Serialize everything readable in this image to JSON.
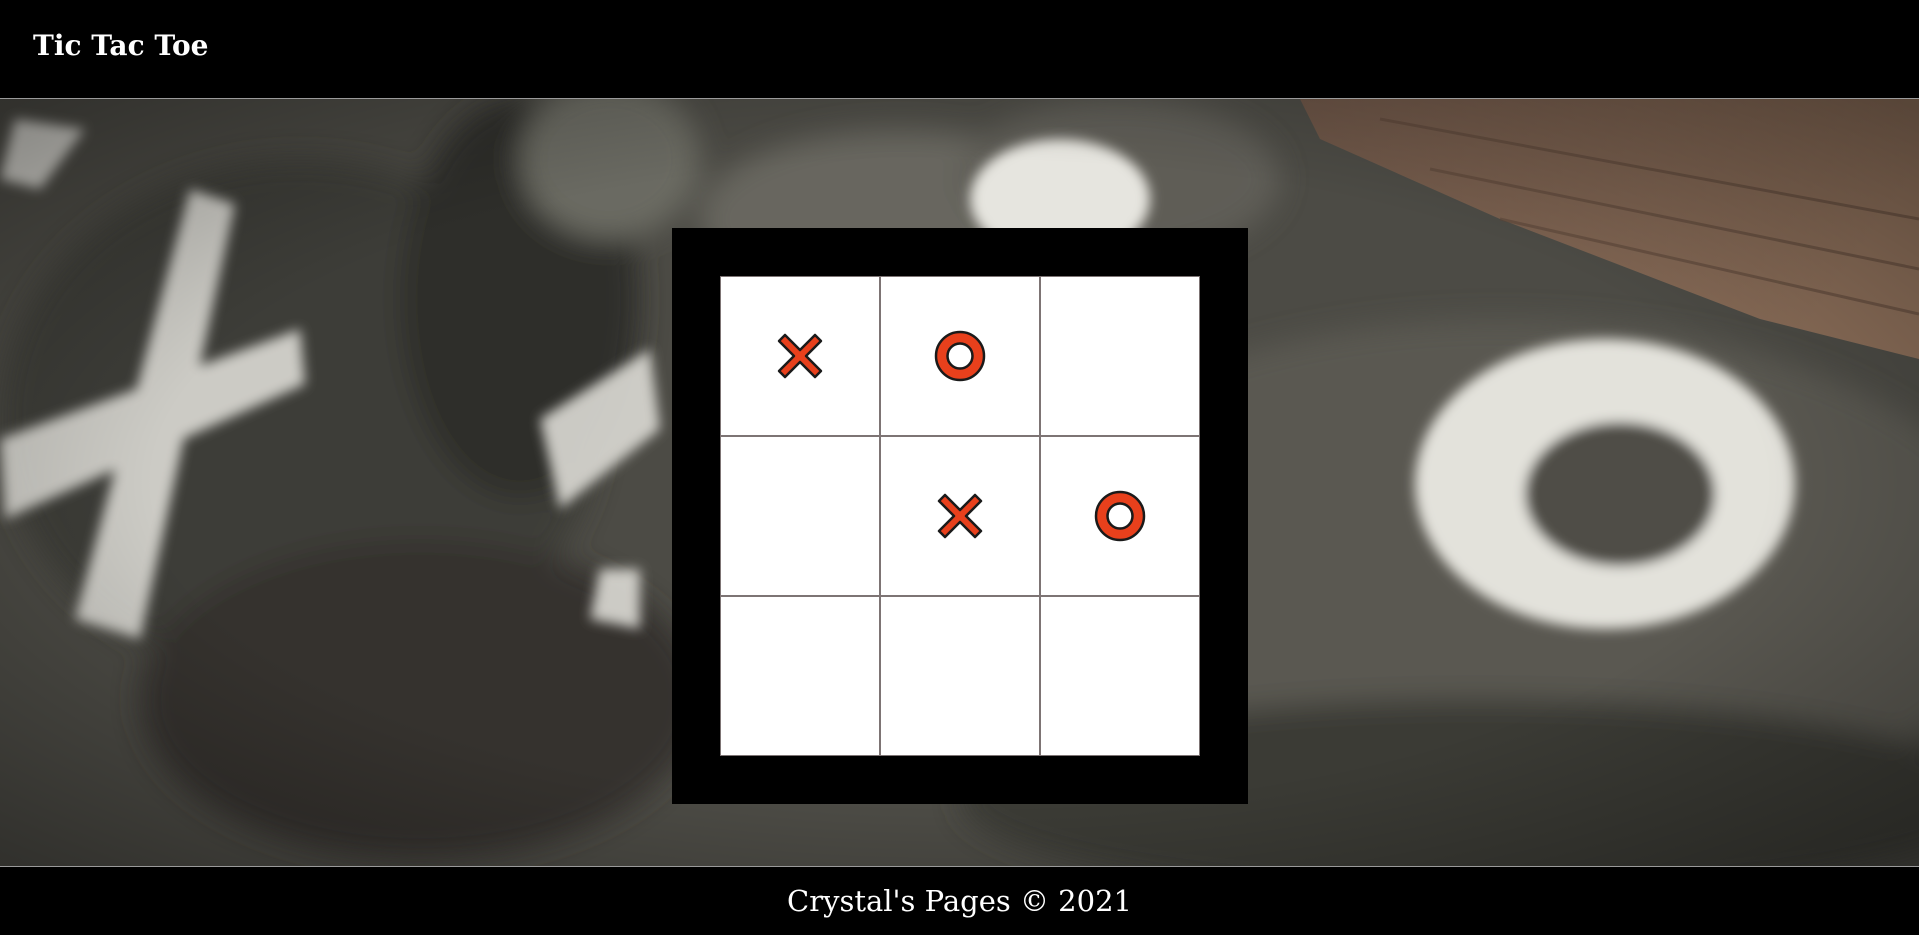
{
  "header": {
    "title": "Tic Tac Toe"
  },
  "board": {
    "cells": [
      "X",
      "O",
      "",
      "",
      "X",
      "O",
      "",
      "",
      ""
    ]
  },
  "footer": {
    "text": "Crystal's Pages © 2021"
  },
  "colors": {
    "mark_fill": "#e8401c",
    "mark_outline": "#1a1a1a",
    "cell_border": "#7d7474",
    "frame": "#000000"
  }
}
